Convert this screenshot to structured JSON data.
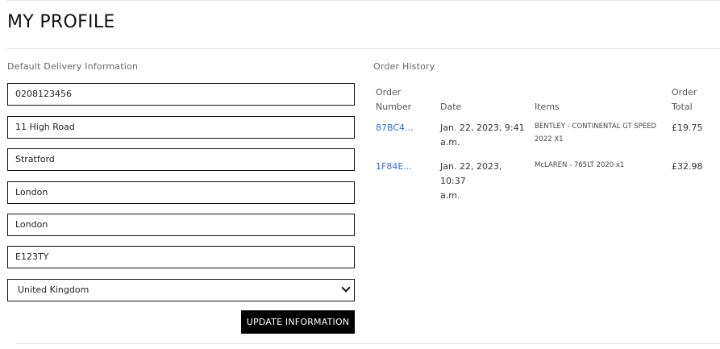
{
  "page": {
    "title": "MY PROFILE"
  },
  "delivery": {
    "label": "Default Delivery Information",
    "phone": "0208123456",
    "street_address1": "11 High Road",
    "street_address2": "Stratford",
    "town_or_city": "London",
    "county": "London",
    "postcode": "E123TY",
    "country": "United Kingdom",
    "update_button_label": "UPDATE INFORMATION"
  },
  "order_history": {
    "label": "Order History",
    "headers": {
      "order_number_line1": "Order",
      "order_number_line2": "Number",
      "date": "Date",
      "items": "Items",
      "order_total_line1": "Order",
      "order_total_line2": "Total"
    },
    "orders": [
      {
        "order_number": "87BC4...",
        "date_line1": "Jan. 22, 2023, 9:41",
        "date_line2": "a.m.",
        "items_line1": "BENTLEY - CONTINENTAL GT SPEED",
        "items_line2": "2022 x1",
        "total": "£19.75"
      },
      {
        "order_number": "1F84E...",
        "date_line1": "Jan. 22, 2023, 10:37",
        "date_line2": "a.m.",
        "items_line1": "McLAREN - 765LT 2020 x1",
        "items_line2": "",
        "total": "£32.98"
      }
    ]
  },
  "colors": {
    "link": "#2f6fd6",
    "button_bg": "#000000",
    "button_text": "#ffffff",
    "field_border": "#111111"
  }
}
